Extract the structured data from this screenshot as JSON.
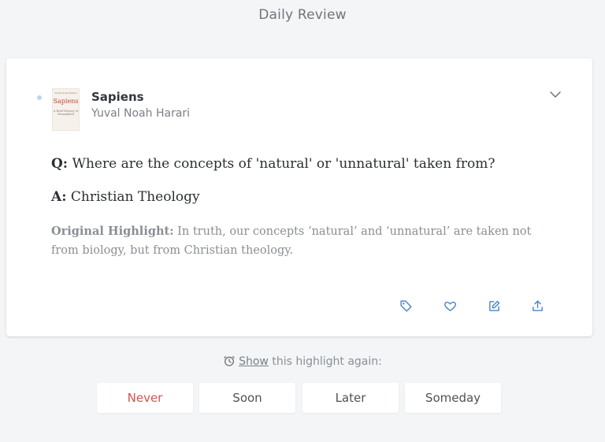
{
  "header": {
    "title": "Daily Review"
  },
  "book": {
    "title": "Sapiens",
    "author": "Yuval Noah Harari",
    "cover": {
      "top": "Yuval Noah Harari",
      "title": "Sapiens",
      "subtitle": "A Brief History of Humankind"
    }
  },
  "card": {
    "question_label": "Q:",
    "question": "Where are the concepts of 'natural' or 'unnatural' taken from?",
    "answer_label": "A:",
    "answer": "Christian Theology",
    "original_label": "Original Highlight:",
    "original_text": "In truth, our concepts ‘natural’ and ‘unnatural’ are taken not from biology, but from Christian theology."
  },
  "actions": [
    "tag-icon",
    "heart-icon",
    "edit-icon",
    "share-icon"
  ],
  "schedule": {
    "link": "Show",
    "prompt": "this highlight again:",
    "buttons": [
      "Never",
      "Soon",
      "Later",
      "Someday"
    ]
  },
  "colors": {
    "never": "#d9534f",
    "dot": "#b9d6f2",
    "icon": "#4a86c5"
  }
}
